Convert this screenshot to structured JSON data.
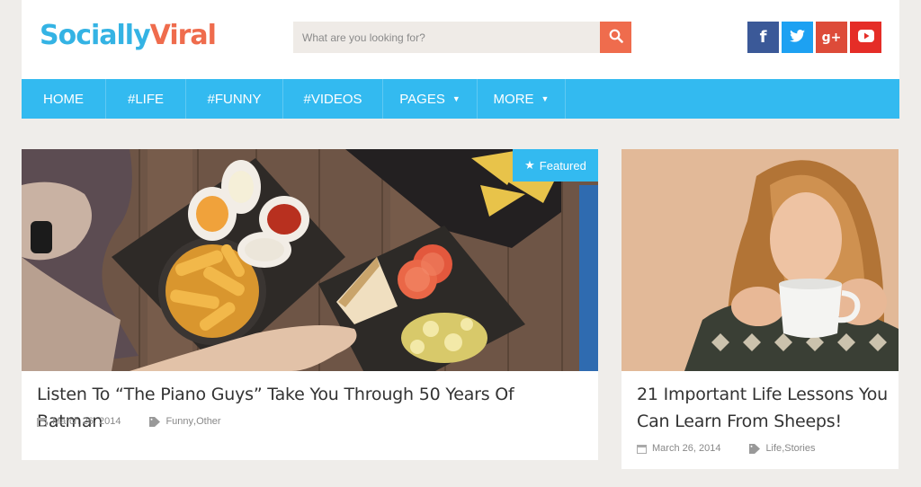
{
  "brand": {
    "part1": "Socially",
    "part2": "Viral"
  },
  "search": {
    "placeholder": "What are you looking for?"
  },
  "social": [
    "facebook-icon",
    "twitter-icon",
    "google-plus-icon",
    "youtube-icon"
  ],
  "social_glyphs": {
    "facebook": "f",
    "google": "g+"
  },
  "nav": {
    "items": [
      {
        "label": "HOME"
      },
      {
        "label": "#LIFE"
      },
      {
        "label": "#FUNNY"
      },
      {
        "label": "#VIDEOS"
      },
      {
        "label": "PAGES"
      },
      {
        "label": "MORE"
      }
    ]
  },
  "posts": [
    {
      "badge": "Featured",
      "title": "Listen To “The Piano Guys” Take You Through 50 Years Of Batman",
      "date": "March 26, 2014",
      "cat1": "Funny",
      "sep": ", ",
      "cat2": "Other"
    },
    {
      "title": "21 Important Life Lessons You Can Learn From Sheeps!",
      "date": "March 26, 2014",
      "cat1": "Life",
      "sep": ", ",
      "cat2": "Stories"
    }
  ],
  "colors": {
    "accent": "#33baf0",
    "orange": "#ef6c4d",
    "background": "#efedea"
  }
}
